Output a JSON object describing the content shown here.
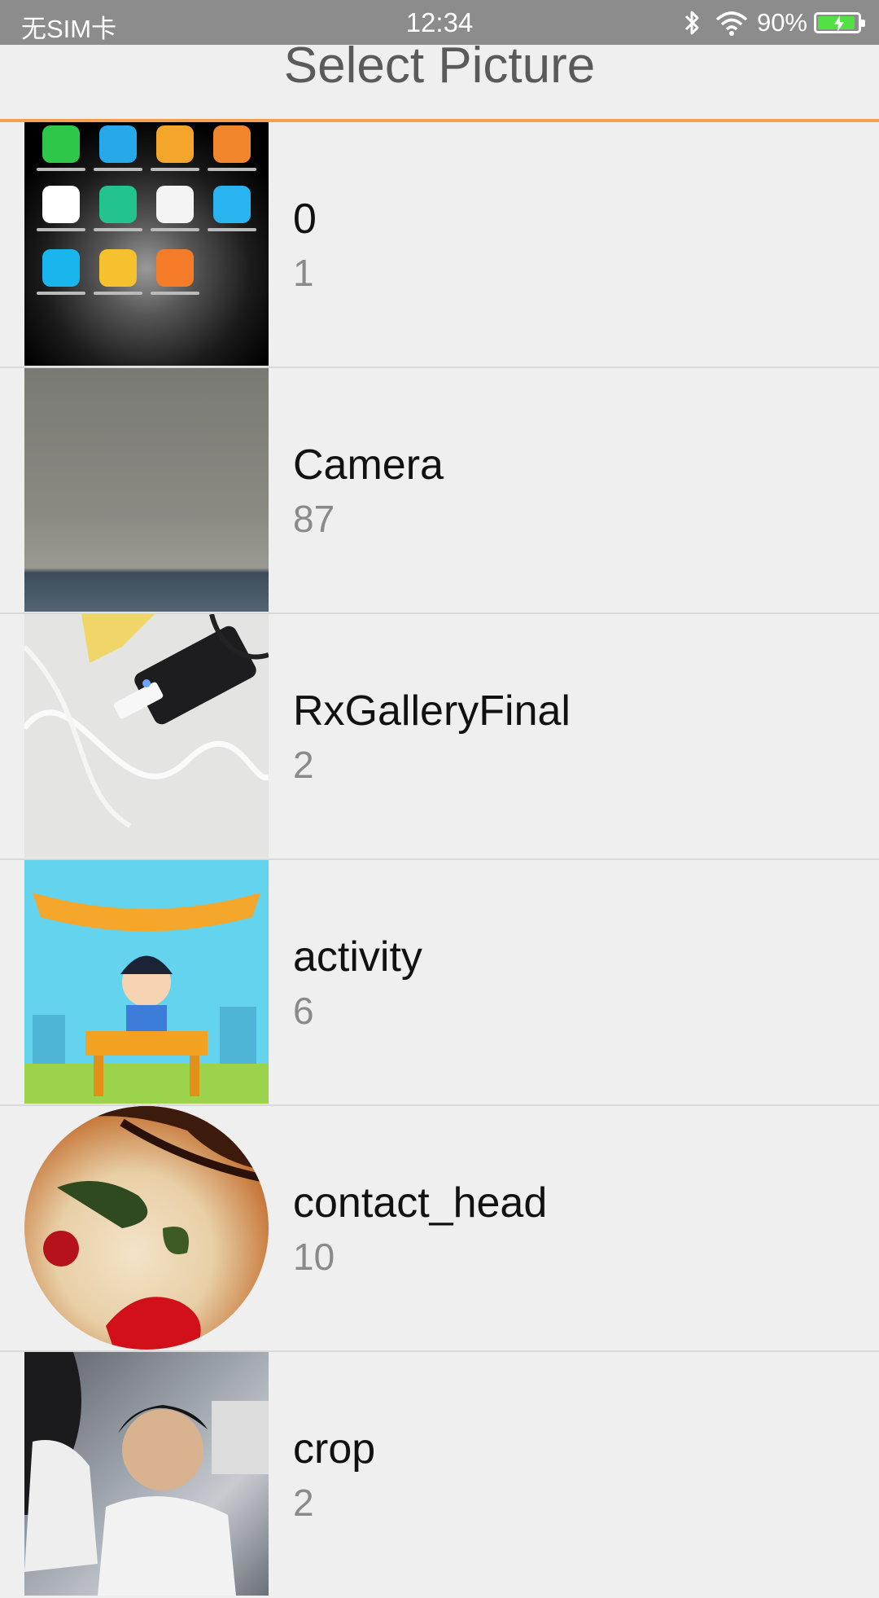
{
  "status_bar": {
    "carrier": "无SIM卡",
    "time": "12:34",
    "battery_percent": "90%",
    "battery_level": 0.9,
    "icons": [
      "bluetooth-icon",
      "wifi-icon",
      "battery-charging-icon"
    ],
    "background_color": "#8c8c8c"
  },
  "header": {
    "title": "Select Picture",
    "accent_color": "#f5a04e"
  },
  "albums": [
    {
      "name": "0",
      "count": "1"
    },
    {
      "name": "Camera",
      "count": "87"
    },
    {
      "name": "RxGalleryFinal",
      "count": "2"
    },
    {
      "name": "activity",
      "count": "6"
    },
    {
      "name": "contact_head",
      "count": "10"
    },
    {
      "name": "crop",
      "count": "2"
    }
  ]
}
